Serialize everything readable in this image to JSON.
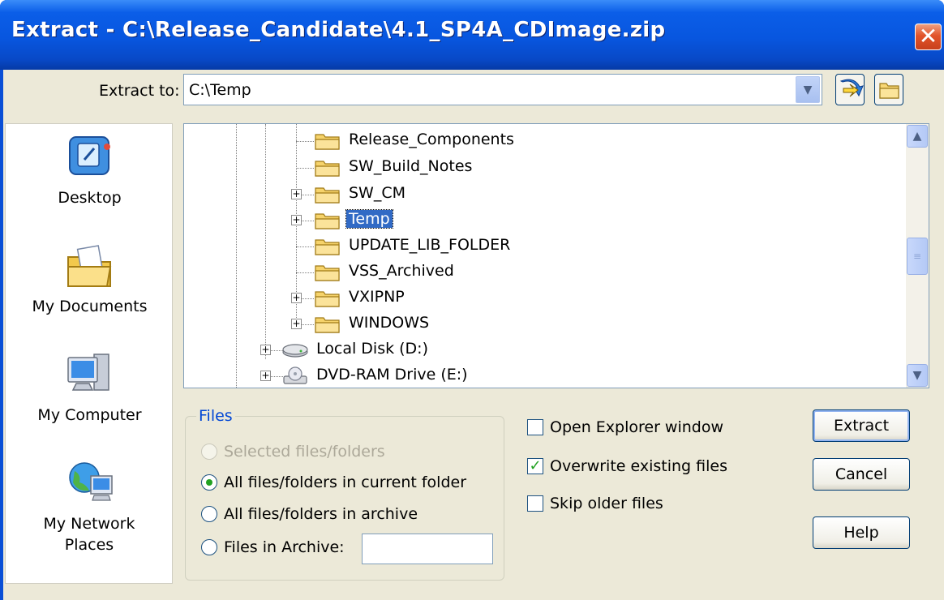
{
  "window": {
    "title": "Extract - C:\\Release_Candidate\\4.1_SP4A_CDImage.zip",
    "close_label": "✕"
  },
  "extract_to": {
    "label": "Extract to:",
    "value": "C:\\Temp"
  },
  "toolbar": {
    "refresh_icon": "refresh-arrow-icon",
    "new_folder_icon": "folder-icon"
  },
  "places": [
    {
      "label": "Desktop",
      "icon": "desktop-icon"
    },
    {
      "label": "My Documents",
      "icon": "my-documents-icon"
    },
    {
      "label": "My Computer",
      "icon": "my-computer-icon"
    },
    {
      "label": "My Network Places",
      "icon": "my-network-places-icon"
    }
  ],
  "tree": {
    "items": [
      {
        "label": "Release_Components",
        "expandable": false,
        "selected": false,
        "icon": "folder-icon"
      },
      {
        "label": "SW_Build_Notes",
        "expandable": false,
        "selected": false,
        "icon": "folder-icon"
      },
      {
        "label": "SW_CM",
        "expandable": true,
        "selected": false,
        "icon": "folder-icon"
      },
      {
        "label": "Temp",
        "expandable": true,
        "selected": true,
        "icon": "folder-icon"
      },
      {
        "label": "UPDATE_LIB_FOLDER",
        "expandable": false,
        "selected": false,
        "icon": "folder-icon"
      },
      {
        "label": "VSS_Archived",
        "expandable": false,
        "selected": false,
        "icon": "folder-icon"
      },
      {
        "label": "VXIPNP",
        "expandable": true,
        "selected": false,
        "icon": "folder-icon"
      },
      {
        "label": "WINDOWS",
        "expandable": true,
        "selected": false,
        "icon": "folder-icon"
      },
      {
        "label": "Local Disk  (D:)",
        "expandable": true,
        "selected": false,
        "icon": "hard-disk-icon"
      },
      {
        "label": "DVD-RAM Drive (E:)",
        "expandable": true,
        "selected": false,
        "icon": "dvd-drive-icon"
      }
    ],
    "expander_symbol": "+"
  },
  "files_group": {
    "legend": "Files",
    "options": [
      {
        "label": "Selected files/folders",
        "checked": false,
        "disabled": true
      },
      {
        "label": "All files/folders in current folder",
        "checked": true,
        "disabled": false
      },
      {
        "label": "All files/folders in archive",
        "checked": false,
        "disabled": false
      },
      {
        "label": "Files in Archive:",
        "checked": false,
        "disabled": false
      }
    ],
    "archive_filter_value": ""
  },
  "options": [
    {
      "label": "Open Explorer window",
      "checked": false
    },
    {
      "label": "Overwrite existing files",
      "checked": true
    },
    {
      "label": "Skip older files",
      "checked": false
    }
  ],
  "buttons": {
    "extract": "Extract",
    "cancel": "Cancel",
    "help": "Help"
  },
  "scrollbar": {
    "up": "▲",
    "down": "▼",
    "grip": "≡"
  },
  "combo_arrow": "▼",
  "check_mark": "✓"
}
